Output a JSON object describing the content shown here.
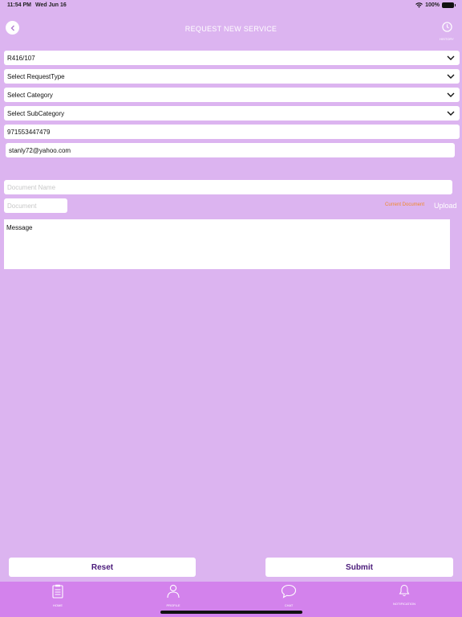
{
  "status": {
    "time": "11:54 PM",
    "date": "Wed Jun 16",
    "battery": "100%"
  },
  "header": {
    "title": "REQUEST NEW SERVICE",
    "history_label": "HISTORY"
  },
  "form": {
    "property": "R416/107",
    "request_type": "Select RequestType",
    "category": "Select Category",
    "subcategory": "Select SubCategory",
    "phone": "971553447479",
    "email": "stanly72@yahoo.com",
    "document_name_placeholder": "Document Name",
    "document_placeholder": "Document",
    "current_document_label": "Current Document",
    "upload_label": "Upload",
    "message_placeholder": "Message"
  },
  "actions": {
    "reset": "Reset",
    "submit": "Submit"
  },
  "tabs": [
    {
      "label": "HOME",
      "icon": "clipboard-icon"
    },
    {
      "label": "PROFILE",
      "icon": "person-icon"
    },
    {
      "label": "CHAT",
      "icon": "chat-bubble-icon"
    },
    {
      "label": "NOTIFICATION",
      "icon": "bell-icon"
    }
  ],
  "colors": {
    "background": "#dcb4f0",
    "tab_bar": "#d382ec",
    "button_text": "#4a1a7a",
    "current_document": "#f08a2b"
  }
}
